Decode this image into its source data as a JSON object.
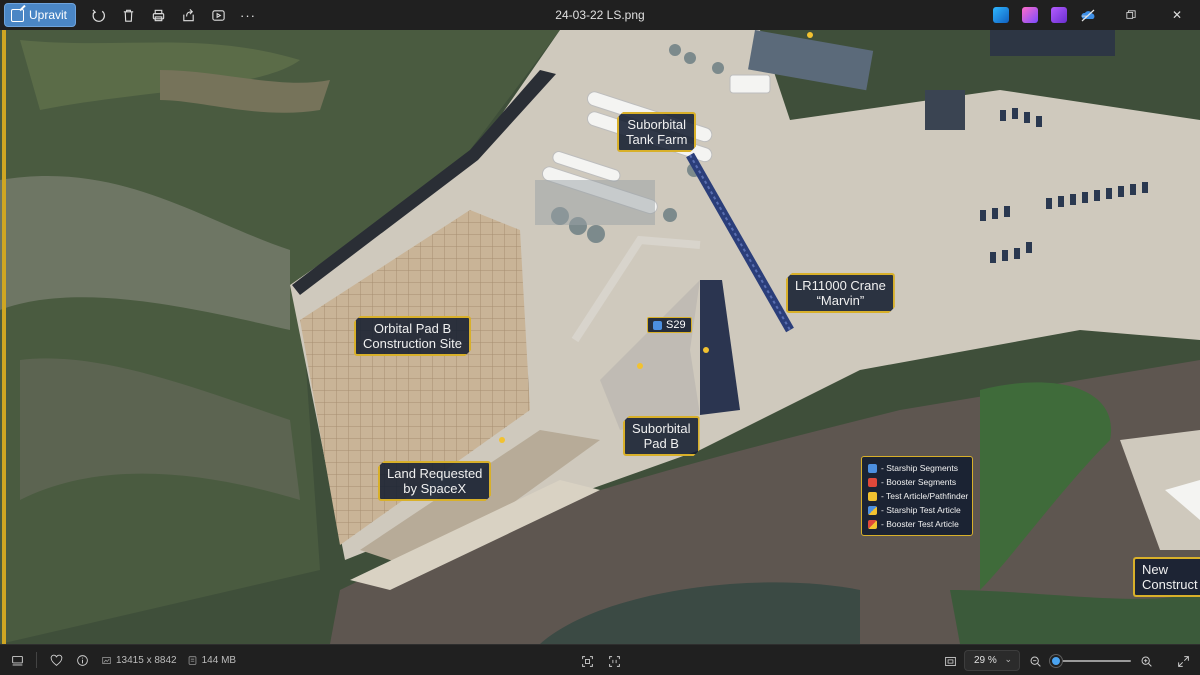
{
  "toolbar": {
    "edit_label": "Upravit",
    "more_label": "···",
    "file_title": "24-03-22 LS.png"
  },
  "colors": {
    "accent": "#4a86c5",
    "callout_border": "#d8b02a",
    "callout_bg": "#141e30"
  },
  "icons": [
    "edit-icon",
    "rotate-icon",
    "delete-icon",
    "print-icon",
    "share-icon",
    "slideshow-icon",
    "more-icon",
    "minimize-icon",
    "maximize-icon",
    "close-icon",
    "filmstrip-icon",
    "favorite-icon",
    "info-icon",
    "dimensions-icon",
    "filesize-icon",
    "fit-icon",
    "actual-size-icon",
    "zoom-out-icon",
    "zoom-in-icon",
    "fullscreen-icon"
  ],
  "callouts": {
    "tank_farm": "Suborbital\nTank Farm",
    "crane": "LR11000 Crane\n“Marvin”",
    "orbital_pad": "Orbital Pad B\nConstruction Site",
    "suborbital_pad": "Suborbital\nPad B",
    "land_requested": "Land Requested\nby SpaceX",
    "new_construction": "New\nConstruct",
    "s29": "S29"
  },
  "legend": [
    {
      "label": "- Starship Segments",
      "color": "#4c8fe0"
    },
    {
      "label": "- Booster Segments",
      "color": "#e0483a"
    },
    {
      "label": "- Test Article/Pathfinder",
      "color": "#f2c230"
    },
    {
      "label": "- Starship Test Article",
      "color": "#4c8fe0",
      "color2": "#f2c230"
    },
    {
      "label": "- Booster Test Article",
      "color": "#e0483a",
      "color2": "#f2c230"
    }
  ],
  "status": {
    "dimensions": "13415 x 8842",
    "filesize": "144 MB",
    "zoom": "29 %",
    "zoom_fraction": 0.06
  }
}
